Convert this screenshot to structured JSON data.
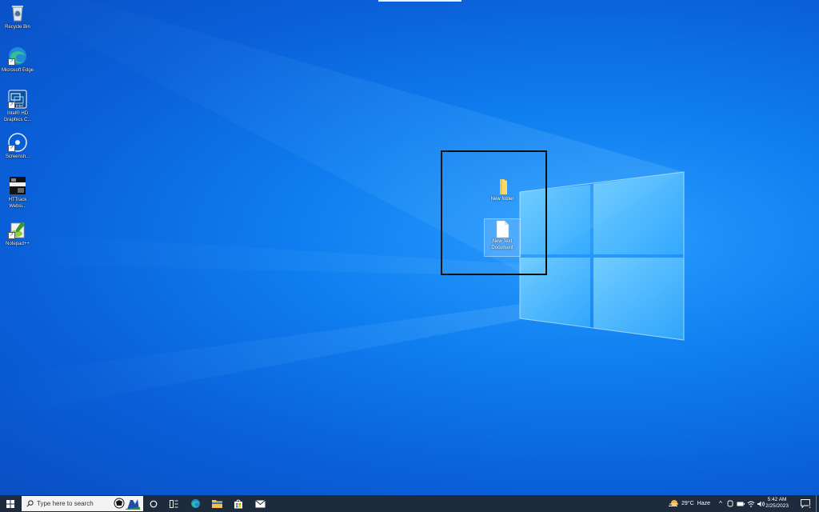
{
  "desktop": {
    "icons": [
      {
        "name": "recycle-bin",
        "label": "Recycle Bin",
        "icon": "recycle-bin-icon"
      },
      {
        "name": "microsoft-edge",
        "label": "Microsoft Edge",
        "icon": "edge-icon"
      },
      {
        "name": "intel-graphics",
        "label": "Intel® HD Graphics C...",
        "icon": "intel-graphics-icon"
      },
      {
        "name": "screenshot",
        "label": "Screensh...",
        "icon": "screenshot-icon"
      },
      {
        "name": "httrack",
        "label": "HTTrack Websi...",
        "icon": "httrack-icon"
      },
      {
        "name": "notepad-plus",
        "label": "Notepad++",
        "icon": "notepad-plus-icon"
      }
    ],
    "files": [
      {
        "name": "new-folder",
        "label": "New folder",
        "icon": "folder-icon"
      },
      {
        "name": "new-text-document",
        "label": "New Text Document",
        "icon": "text-document-icon"
      }
    ]
  },
  "taskbar": {
    "search_placeholder": "Type here to search",
    "weather_temp": "29°C",
    "weather_condition": "Haze",
    "time": "5:42 AM",
    "date": "2/25/2023",
    "notification_count": "1"
  },
  "colors": {
    "taskbar_bg": "#1d2b3d",
    "desktop_accent": "#0f7ef0"
  }
}
